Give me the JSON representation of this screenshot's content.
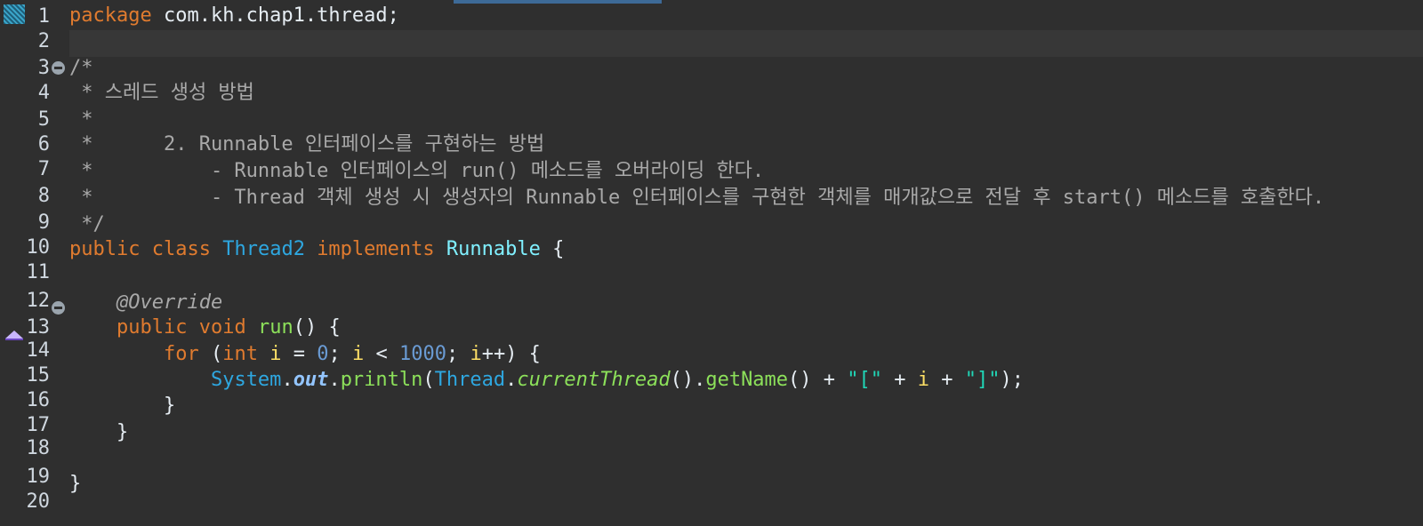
{
  "editor": {
    "line_numbers": [
      "1",
      "2",
      "3",
      "4",
      "5",
      "6",
      "7",
      "8",
      "9",
      "10",
      "11",
      "12",
      "13",
      "14",
      "15",
      "16",
      "17",
      "18",
      "19",
      "20"
    ],
    "line1": {
      "kw": "package",
      "rest": " com.kh.chap1.thread;"
    },
    "line3": {
      "text": "/*"
    },
    "line4": {
      "text": " * 스레드 생성 방법"
    },
    "line5": {
      "text": " *"
    },
    "line6": {
      "text": " *      2. Runnable 인터페이스를 구현하는 방법"
    },
    "line7": {
      "text": " *          - Runnable 인터페이스의 run() 메소드를 오버라이딩 한다."
    },
    "line8": {
      "text": " *          - Thread 객체 생성 시 생성자의 Runnable 인터페이스를 구현한 객체를 매개값으로 전달 후 start() 메소드를 호출한다."
    },
    "line9": {
      "text": " */"
    },
    "line10": {
      "kw1": "public",
      "kw2": "class",
      "cls": "Thread2",
      "kw3": "implements",
      "iface": "Runnable",
      "brace": "{"
    },
    "line12": {
      "ann": "@Override"
    },
    "line13": {
      "kw1": "public",
      "kw2": "void",
      "meth": "run",
      "rest": "() {"
    },
    "line15": {
      "kw_for": "for",
      "paren_open": "(",
      "kw_int": "int",
      "var_i": "i",
      "assign": "=",
      "zero": "0",
      "semi1": ";",
      "lt": "<",
      "limit": "1000",
      "semi2": ";",
      "inc": "++) {"
    },
    "line16": {
      "sys": "System",
      "dot1": ".",
      "out": "out",
      "dot2": ".",
      "println": "println",
      "p_open": "(",
      "thread": "Thread",
      "dot3": ".",
      "current": "currentThread",
      "p_pair": "().",
      "getname": "getName",
      "plus_open": "() + ",
      "str_open": "\"[\"",
      "plus2": " + ",
      "plus3": " + ",
      "str_close": "\"]\"",
      "end": ");"
    },
    "line17": {
      "text": "}"
    },
    "line18": {
      "text": "}"
    },
    "line20": {
      "text": "}"
    }
  }
}
